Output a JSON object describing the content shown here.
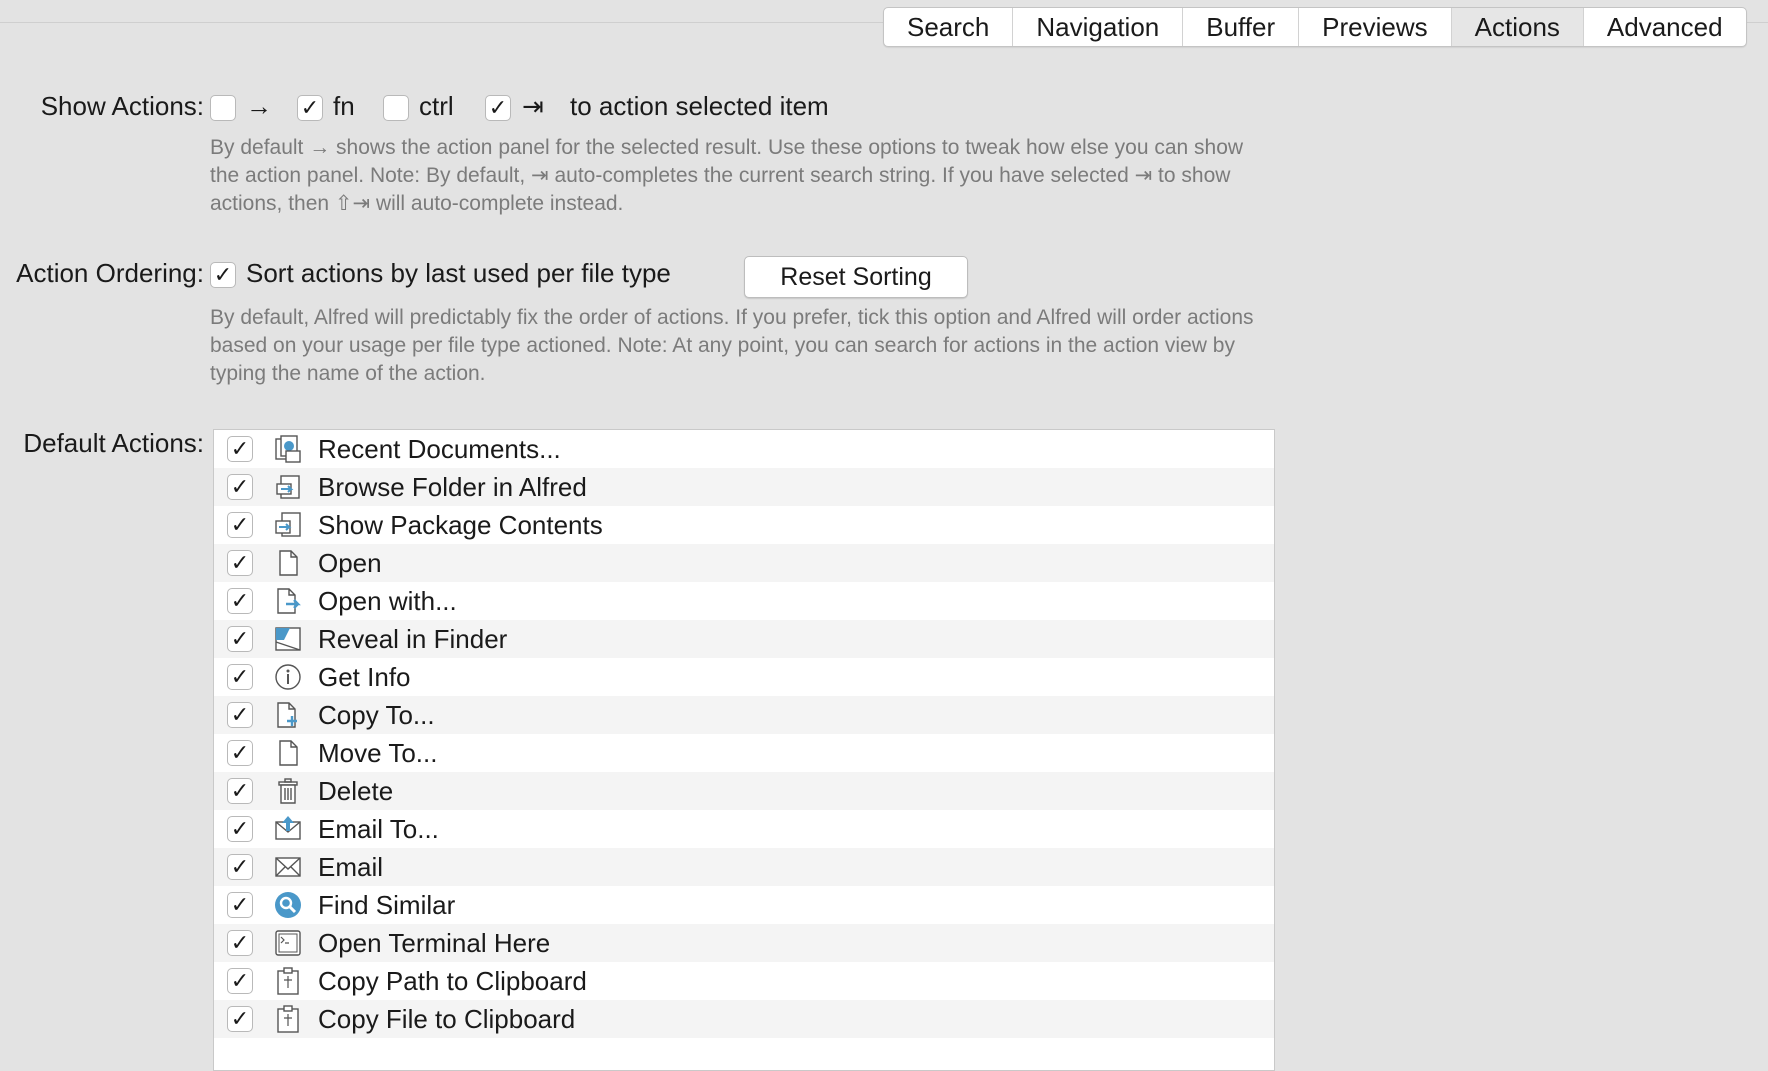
{
  "tabs": [
    {
      "label": "Search"
    },
    {
      "label": "Navigation"
    },
    {
      "label": "Buffer"
    },
    {
      "label": "Previews"
    },
    {
      "label": "Actions",
      "active": true
    },
    {
      "label": "Advanced"
    }
  ],
  "show_actions": {
    "label": "Show Actions:",
    "options": [
      {
        "symbol": "→",
        "checked": false
      },
      {
        "symbol": "fn",
        "checked": true
      },
      {
        "symbol": "ctrl",
        "checked": false
      },
      {
        "symbol": "⇥",
        "checked": true
      }
    ],
    "suffix": "to action selected item",
    "help": "By default → shows the action panel for the selected result. Use these options to tweak how else you can show the action panel. Note: By default, ⇥ auto-completes the current search string. If you have selected ⇥ to show actions, then ⇧⇥ will auto-complete instead."
  },
  "action_ordering": {
    "label": "Action Ordering:",
    "checkbox_label": "Sort actions by last used per file type",
    "checked": true,
    "button_label": "Reset Sorting",
    "help": "By default, Alfred will predictably fix the order of actions. If you prefer, tick this option and Alfred will order actions based on your usage per file type actioned. Note: At any point, you can search for actions in the action view by typing the name of the action."
  },
  "default_actions": {
    "label": "Default Actions:",
    "items": [
      {
        "label": "Recent Documents...",
        "icon": "recent-documents-icon",
        "checked": true
      },
      {
        "label": "Browse Folder in Alfred",
        "icon": "browse-folder-icon",
        "checked": true
      },
      {
        "label": "Show Package Contents",
        "icon": "package-contents-icon",
        "checked": true
      },
      {
        "label": "Open",
        "icon": "document-icon",
        "checked": true
      },
      {
        "label": "Open with...",
        "icon": "open-with-icon",
        "checked": true
      },
      {
        "label": "Reveal in Finder",
        "icon": "finder-icon",
        "checked": true
      },
      {
        "label": "Get Info",
        "icon": "info-icon",
        "checked": true
      },
      {
        "label": "Copy To...",
        "icon": "copy-to-icon",
        "checked": true
      },
      {
        "label": "Move To...",
        "icon": "move-to-icon",
        "checked": true
      },
      {
        "label": "Delete",
        "icon": "trash-icon",
        "checked": true
      },
      {
        "label": "Email To...",
        "icon": "email-to-icon",
        "checked": true
      },
      {
        "label": "Email",
        "icon": "envelope-icon",
        "checked": true
      },
      {
        "label": "Find Similar",
        "icon": "magnifier-icon",
        "checked": true
      },
      {
        "label": "Open Terminal Here",
        "icon": "terminal-icon",
        "checked": true
      },
      {
        "label": "Copy Path to Clipboard",
        "icon": "clipboard-icon",
        "checked": true
      },
      {
        "label": "Copy File to Clipboard",
        "icon": "clipboard-icon",
        "checked": true
      }
    ]
  },
  "colors": {
    "background": "#e3e3e3",
    "help_text": "#7b7b7b",
    "accent_icon": "#4a98c9"
  }
}
